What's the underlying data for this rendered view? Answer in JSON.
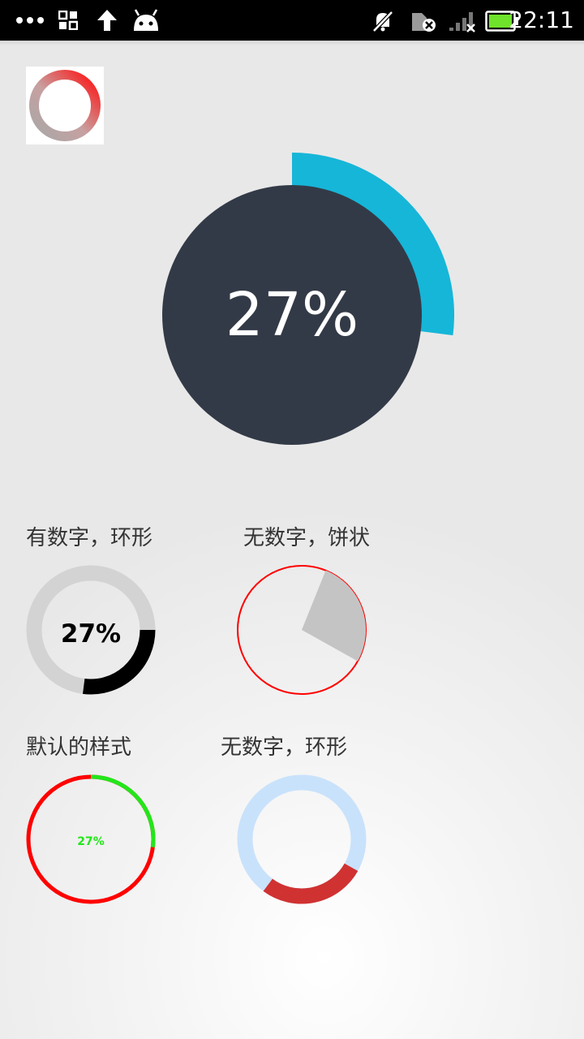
{
  "status_bar": {
    "time": "22:11",
    "icons": [
      "more-icon",
      "apps-icon",
      "upload-icon",
      "android-icon",
      "mute-icon",
      "sim-icon",
      "signal-icon",
      "battery-icon"
    ]
  },
  "app_icon": "ring-progress-logo",
  "main_progress": {
    "percent": 27,
    "text": "27%",
    "colors": {
      "circle": "#333a47",
      "arc": "#16b6d8",
      "text": "#ffffff"
    }
  },
  "widgets": [
    {
      "label": "有数字，环形",
      "text": "27%",
      "percent": 27,
      "style": "ring-with-number",
      "colors": {
        "track": "#d3d3d3",
        "progress": "#000000"
      }
    },
    {
      "label": "无数字，饼状",
      "percent": 27,
      "style": "pie",
      "colors": {
        "outline": "#ff0000",
        "fill": "#c4c4c4"
      }
    },
    {
      "label": "默认的样式",
      "text": "27%",
      "percent": 27,
      "style": "default",
      "colors": {
        "ring": "#ff0000",
        "progress": "#22e61a",
        "text": "#22e61a"
      }
    },
    {
      "label": "无数字，环形",
      "percent": 27,
      "style": "ring",
      "colors": {
        "track": "#c9e2fb",
        "progress": "#d03232"
      }
    }
  ]
}
